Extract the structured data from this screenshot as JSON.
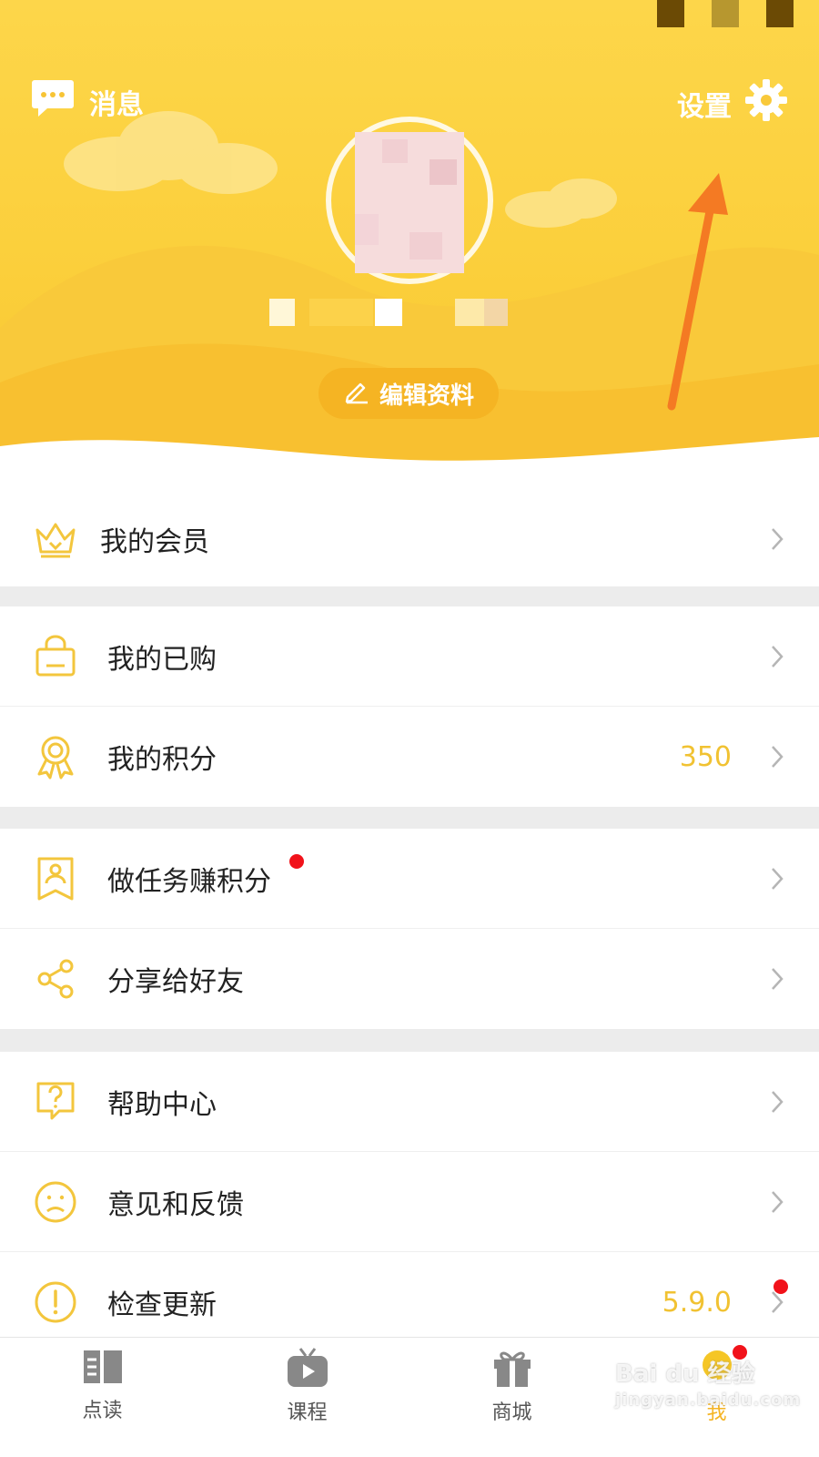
{
  "header": {
    "messages_label": "消息",
    "settings_label": "设置",
    "edit_profile_label": "编辑资料"
  },
  "menu": {
    "group1": [
      {
        "label": "我的会员",
        "icon": "crown-icon"
      }
    ],
    "group2": [
      {
        "label": "我的已购",
        "icon": "shopping-bag-icon"
      },
      {
        "label": "我的积分",
        "icon": "award-ribbon-icon",
        "value": "350"
      }
    ],
    "group3": [
      {
        "label": "做任务赚积分",
        "icon": "task-badge-icon",
        "badge": "red-dot"
      },
      {
        "label": "分享给好友",
        "icon": "share-icon"
      }
    ],
    "group4": [
      {
        "label": "帮助中心",
        "icon": "help-question-icon"
      },
      {
        "label": "意见和反馈",
        "icon": "sad-face-icon"
      },
      {
        "label": "检查更新",
        "icon": "exclamation-icon",
        "value": "5.9.0",
        "badge": "red-dot"
      }
    ]
  },
  "tabbar": {
    "tabs": [
      {
        "label": "点读",
        "icon": "book-icon"
      },
      {
        "label": "课程",
        "icon": "tv-play-icon"
      },
      {
        "label": "商城",
        "icon": "gift-icon"
      },
      {
        "label": "我",
        "icon": "profile-icon",
        "active": true
      }
    ]
  },
  "watermark": {
    "line1": "Bai du 经验",
    "line2": "jingyan.baidu.com"
  },
  "colors": {
    "accent": "#f5b423",
    "header_yellow": "#fbcf3b",
    "value_yellow": "#f1c232",
    "arrow": "#f47a23",
    "badge_red": "#f1121a"
  }
}
